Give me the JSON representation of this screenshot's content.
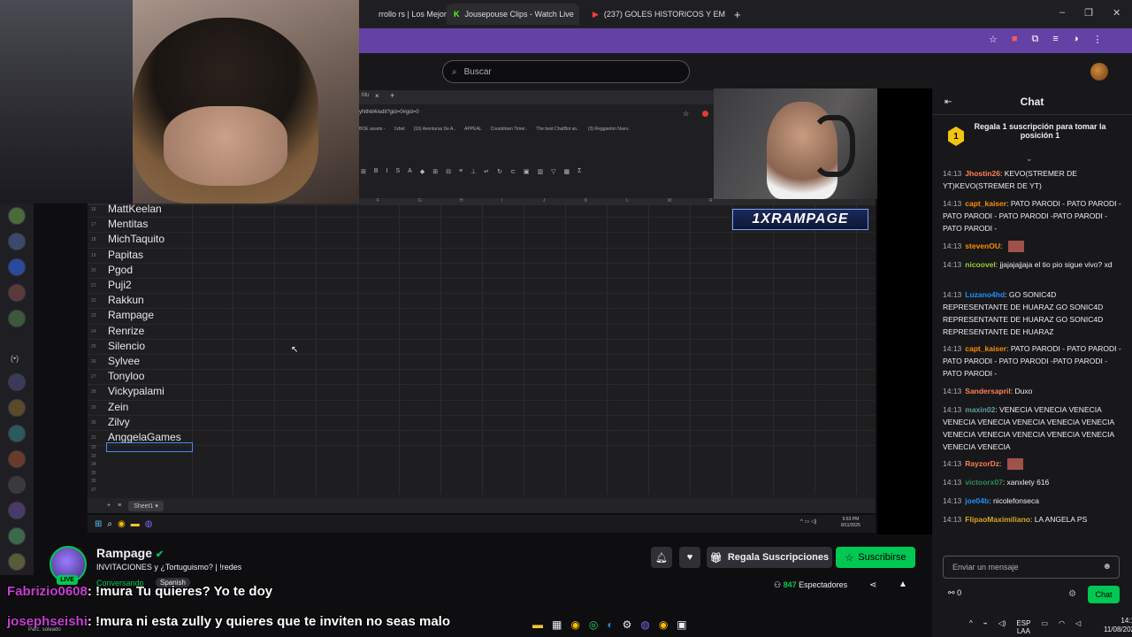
{
  "browser": {
    "tabs": [
      {
        "label": "rrollo rs | Los Mejor"
      },
      {
        "label": "Jousepouse Clips - Watch Live"
      },
      {
        "label": "(237) GOLES HISTORICOS Y EM"
      }
    ]
  },
  "twitch": {
    "search_placeholder": "Buscar"
  },
  "inner_browser": {
    "url": "yNthkl4/edit?gid=0#gid=0",
    "bookmarks": [
      "BOE assets -",
      "1xbet",
      "(16) Aventuras De A..",
      "APPEAL",
      "Countdown Timer..",
      "The best ChatBot an..",
      "(3) Reggaeton Nuev.."
    ]
  },
  "sheet": {
    "columns": [
      "F",
      "G",
      "H",
      "I",
      "J",
      "K",
      "L",
      "M",
      "R"
    ],
    "rows": [
      {
        "num": "16",
        "name": "MattKeelan"
      },
      {
        "num": "17",
        "name": "Mentitas"
      },
      {
        "num": "18",
        "name": "MichTaquito"
      },
      {
        "num": "19",
        "name": "Papitas"
      },
      {
        "num": "20",
        "name": "Pgod"
      },
      {
        "num": "21",
        "name": "Puji2"
      },
      {
        "num": "22",
        "name": "Rakkun"
      },
      {
        "num": "23",
        "name": "Rampage"
      },
      {
        "num": "24",
        "name": "Renrize"
      },
      {
        "num": "25",
        "name": "Silencio"
      },
      {
        "num": "26",
        "name": "Sylvee"
      },
      {
        "num": "27",
        "name": "Tonyloo"
      },
      {
        "num": "28",
        "name": "Vickypalami"
      },
      {
        "num": "29",
        "name": "Zein"
      },
      {
        "num": "30",
        "name": "Zilvy"
      },
      {
        "num": "31",
        "name": "AnggelaGames"
      }
    ],
    "empty_rows": [
      "32",
      "33",
      "34",
      "35",
      "36",
      "37"
    ],
    "sheet_tab": "Sheet1",
    "win_clock": "5:53 PM",
    "win_date": "8/11/2025"
  },
  "overlay_badge": "1XRAMPAGE",
  "chat": {
    "title": "Chat",
    "promo": "Regala 1 suscripción para tomar la posición 1",
    "promo_rank": "1",
    "messages": [
      {
        "time": "14:13",
        "user": "Jhostin26",
        "color": "#ff7f50",
        "text": "KEVO(STREMER DE YT)KEVO(STREMER DE YT)"
      },
      {
        "time": "14:13",
        "user": "capt_kaiser",
        "color": "#ff8c00",
        "text": "PATO PARODI - PATO PARODI - PATO PARODI - PATO PARODI -PATO PARODI - PATO PARODI -"
      },
      {
        "time": "14:13",
        "user": "stevenOU",
        "color": "#ff8c00",
        "text": ""
      },
      {
        "time": "14:13",
        "user": "nicoovel",
        "color": "#9acd32",
        "text": "jjajajajjaja el tio pio sigue vivo? xd"
      },
      {
        "time": "14:13",
        "user": "Luzano4hd",
        "color": "#1e90ff",
        "text": "GO SONIC4D REPRESENTANTE DE HUARAZ GO SONIC4D REPRESENTANTE DE HUARAZ GO SONIC4D REPRESENTANTE DE HUARAZ"
      },
      {
        "time": "14:13",
        "user": "capt_kaiser",
        "color": "#ff8c00",
        "text": "PATO PARODI - PATO PARODI - PATO PARODI - PATO PARODI -PATO PARODI - PATO PARODI -"
      },
      {
        "time": "14:13",
        "user": "Sandersapril",
        "color": "#ff7f50",
        "text": "Duxo"
      },
      {
        "time": "14:13",
        "user": "maxin02",
        "color": "#5f9ea0",
        "text": "VENECIA VENECIA VENECIA VENECIA VENECIA VENECIA VENECIA VENECIA VENECIA VENECIA VENECIA VENECIA VENECIA VENECIA VENECIA"
      },
      {
        "time": "14:13",
        "user": "RayzorDz",
        "color": "#ff7f50",
        "text": ""
      },
      {
        "time": "14:13",
        "user": "victoorx07",
        "color": "#2e8b57",
        "text": "xanxlety 616"
      },
      {
        "time": "14:13",
        "user": "joe04b",
        "color": "#1e90ff",
        "text": "nicolefonseca"
      },
      {
        "time": "14:13",
        "user": "FlipaoMaximiliano",
        "color": "#daa520",
        "text": "LA ANGELA PS"
      }
    ],
    "input_placeholder": "Enviar un mensaje",
    "points": "0",
    "send_label": "Chat"
  },
  "stream": {
    "name": "Rampage",
    "live_label": "LIVE",
    "title": "INVITACIONES y ¿Tortuguismo? | !redes",
    "category": "Conversando",
    "language": "Spanish",
    "gift_label": "Regala Suscripciones",
    "subscribe_label": "Suscribirse",
    "viewers_count": "847",
    "viewers_label": "Espectadores"
  },
  "overlay_chat": [
    {
      "user": "Fabrizio0608",
      "text": ": !mura Tu quieres? Yo te doy"
    },
    {
      "user": "josephseishi",
      "text": ": !mura ni esta zully y quieres que te inviten no seas malo"
    }
  ],
  "taskbar": {
    "left_label": "Parc. soleado",
    "lang_top": "ESP",
    "lang_bottom": "LAA",
    "time": "14:13",
    "date": "11/08/2025"
  },
  "colors": {
    "twitch_purple": "#6441a5",
    "accent_green": "#00c853"
  }
}
